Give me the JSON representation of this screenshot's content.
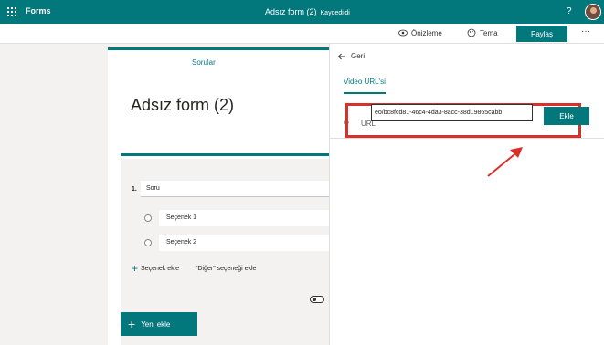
{
  "header": {
    "app_name": "Forms",
    "title": "Adsız form (2)",
    "status": "Kaydedildi",
    "help": "?"
  },
  "toolbar": {
    "preview": "Önizleme",
    "theme": "Tema",
    "share": "Paylaş",
    "more": "···"
  },
  "editor": {
    "tab": "Sorular",
    "form_title": "Adsız form (2)",
    "question": {
      "number": "1.",
      "text": "Soru",
      "options": [
        "Seçenek 1",
        "Seçenek 2"
      ]
    },
    "add_option": "Seçenek ekle",
    "add_other": "\"Diğer\" seçeneği ekle",
    "new_button": "Yeni ekle"
  },
  "panel": {
    "back": "Geri",
    "tab": "Video URL'si",
    "url_label": "URL",
    "url_value": "eo/bc8fcd81-46c4-4da3-8acc-38d19865cabb",
    "add_button": "Ekle"
  },
  "colors": {
    "accent": "#03787c",
    "highlight": "#d9302a"
  },
  "icons": [
    "waffle-icon",
    "eye-icon",
    "palette-icon",
    "back-arrow-icon",
    "link-icon",
    "plus-icon"
  ]
}
